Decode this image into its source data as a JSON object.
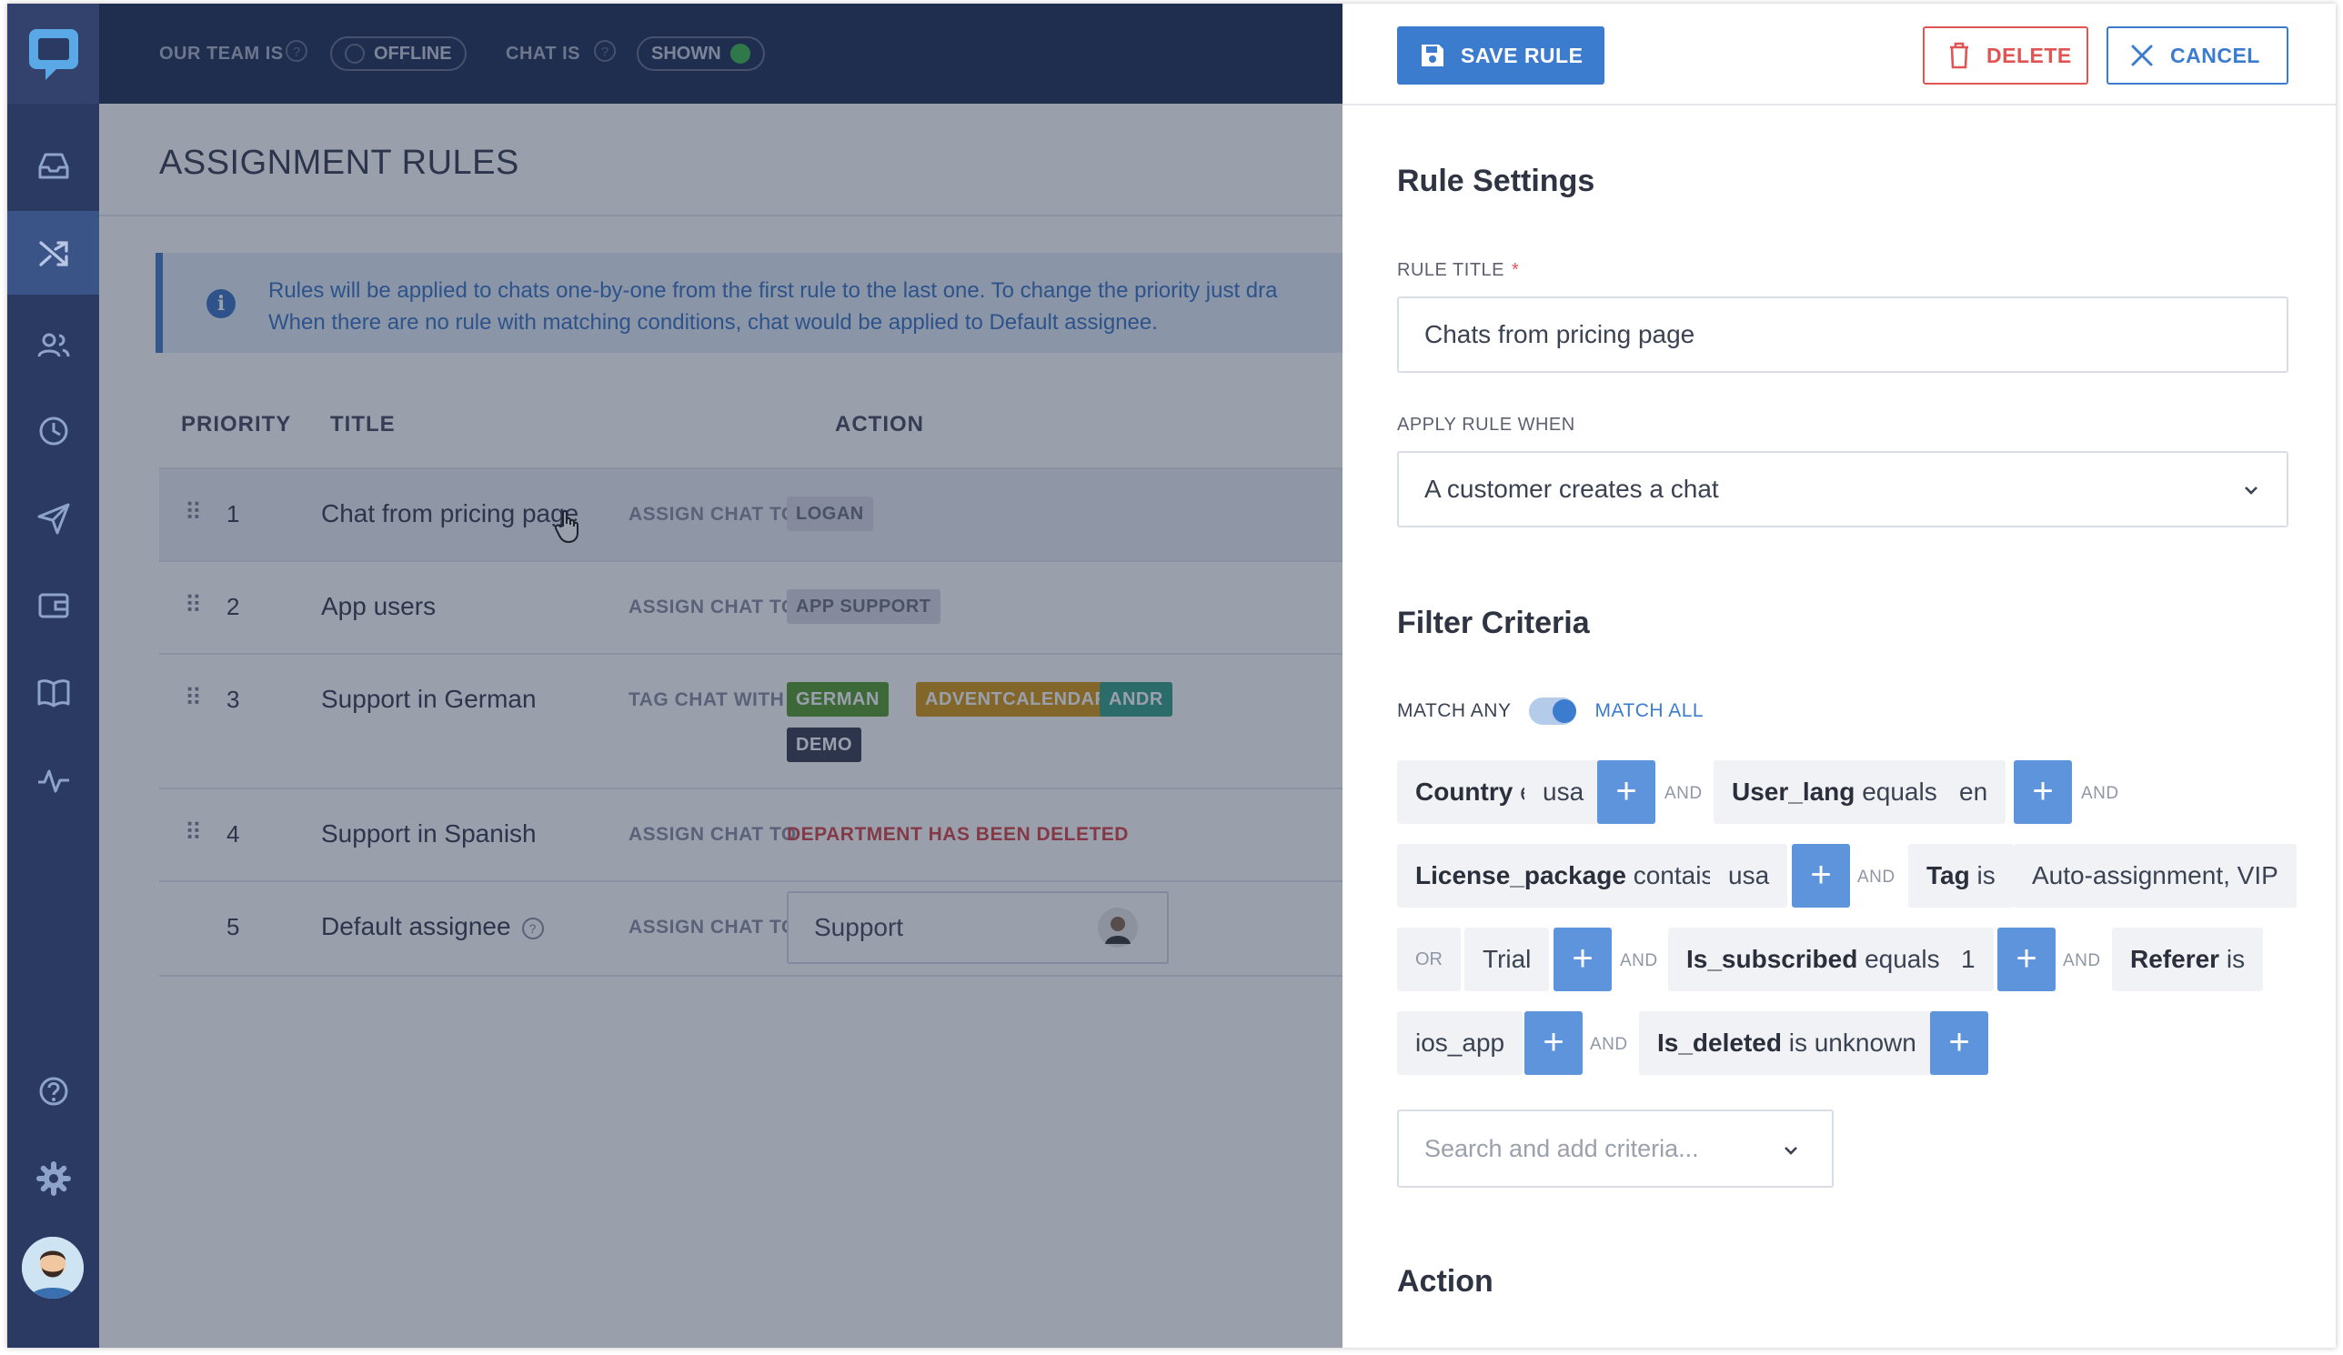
{
  "topbar": {
    "team_label": "OUR TEAM IS",
    "team_status": "OFFLINE",
    "chat_label": "CHAT IS",
    "chat_status": "SHOWN",
    "help_glyph": "?"
  },
  "sidebar": {
    "items": [
      "inbox-icon",
      "shuffle-icon",
      "users-icon",
      "clock-icon",
      "send-icon",
      "wallet-icon",
      "book-icon",
      "activity-icon",
      "help-icon",
      "gear-icon"
    ],
    "active": "shuffle-icon"
  },
  "page": {
    "title": "ASSIGNMENT RULES",
    "info_line1": "Rules will be applied to chats one-by-one from the first rule to the last one. To change the priority just dra",
    "info_line2": "When there are no rule with matching conditions, chat would be applied to Default assignee."
  },
  "table": {
    "columns": [
      "PRIORITY",
      "TITLE",
      "ACTION"
    ],
    "rows": [
      {
        "priority": "1",
        "title": "Chat from pricing page",
        "action_label": "ASSIGN CHAT TO",
        "value": "LOGAN"
      },
      {
        "priority": "2",
        "title": "App users",
        "action_label": "ASSIGN CHAT TO",
        "value": "APP SUPPORT"
      },
      {
        "priority": "3",
        "title": "Support in German",
        "action_label": "TAG CHAT WITH",
        "tags": [
          "GERMAN",
          "ADVENTCALENDAR",
          "ANDR",
          "DEMO"
        ]
      },
      {
        "priority": "4",
        "title": "Support in Spanish",
        "action_label": "ASSIGN CHAT TO",
        "value": "DEPARTMENT HAS BEEN DELETED"
      },
      {
        "priority": "5",
        "title": "Default assignee",
        "action_label": "ASSIGN CHAT TO",
        "value": "Support"
      }
    ]
  },
  "panel": {
    "save_label": "SAVE RULE",
    "delete_label": "DELETE",
    "cancel_label": "CANCEL",
    "settings_heading": "Rule Settings",
    "rule_title_label": "RULE TITLE",
    "required_mark": "*",
    "rule_title_value": "Chats from pricing page",
    "apply_label": "APPLY RULE WHEN",
    "apply_value": "A customer creates a chat",
    "filter_heading": "Filter Criteria",
    "match_any": "MATCH ANY",
    "match_all": "MATCH ALL",
    "match_all_selected": true,
    "and_label": "AND",
    "or_label": "OR",
    "criteria": {
      "c1_field": "Country",
      "c1_op": "equals",
      "c1_val": "usa",
      "c2_field": "User_lang",
      "c2_op": "equals",
      "c2_val": "en",
      "c3_field": "License_package",
      "c3_op": "contais",
      "c3_val": "usa",
      "c4_field": "Tag",
      "c4_op": "is",
      "c4_val": "Auto-assignment, VIP",
      "c4_val2": "Trial",
      "c5_field": "Is_subscribed",
      "c5_op": "equals",
      "c5_val": "1",
      "c6_field": "Referer",
      "c6_op": "is",
      "c6_val": "ios_app",
      "c7_field": "Is_deleted",
      "c7_op": "is unknown"
    },
    "search_placeholder": "Search and add criteria...",
    "action_heading": "Action"
  },
  "colors": {
    "accent": "#3b7ccf",
    "danger": "#e05454",
    "tag_green": "#5a9e2f",
    "tag_orange": "#d69a16",
    "tag_teal": "#3aa58a",
    "tag_dark": "#3b4252",
    "online_dot": "#3fb950"
  }
}
